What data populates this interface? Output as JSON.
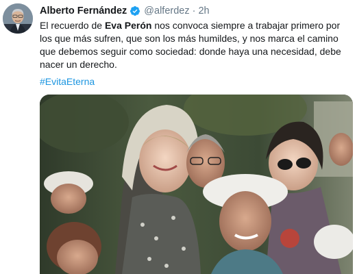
{
  "tweet": {
    "author_name": "Alberto Fernández",
    "handle": "@alferdez",
    "separator": "·",
    "time": "2h",
    "text_part1": "El recuerdo de ",
    "text_bold": "Eva Perón",
    "text_part2": " nos convoca siempre a trabajar primero por los que más sufren, que son los más humildes, y nos marca el camino que debemos seguir como sociedad: donde haya una necesidad, debe nacer un derecho.",
    "hashtag": "#EvitaEterna"
  },
  "icons": {
    "verified": "verified-badge-icon"
  },
  "colors": {
    "link": "#1b95e0",
    "verified": "#1da1f2",
    "muted": "#657786",
    "text": "#14171a"
  }
}
